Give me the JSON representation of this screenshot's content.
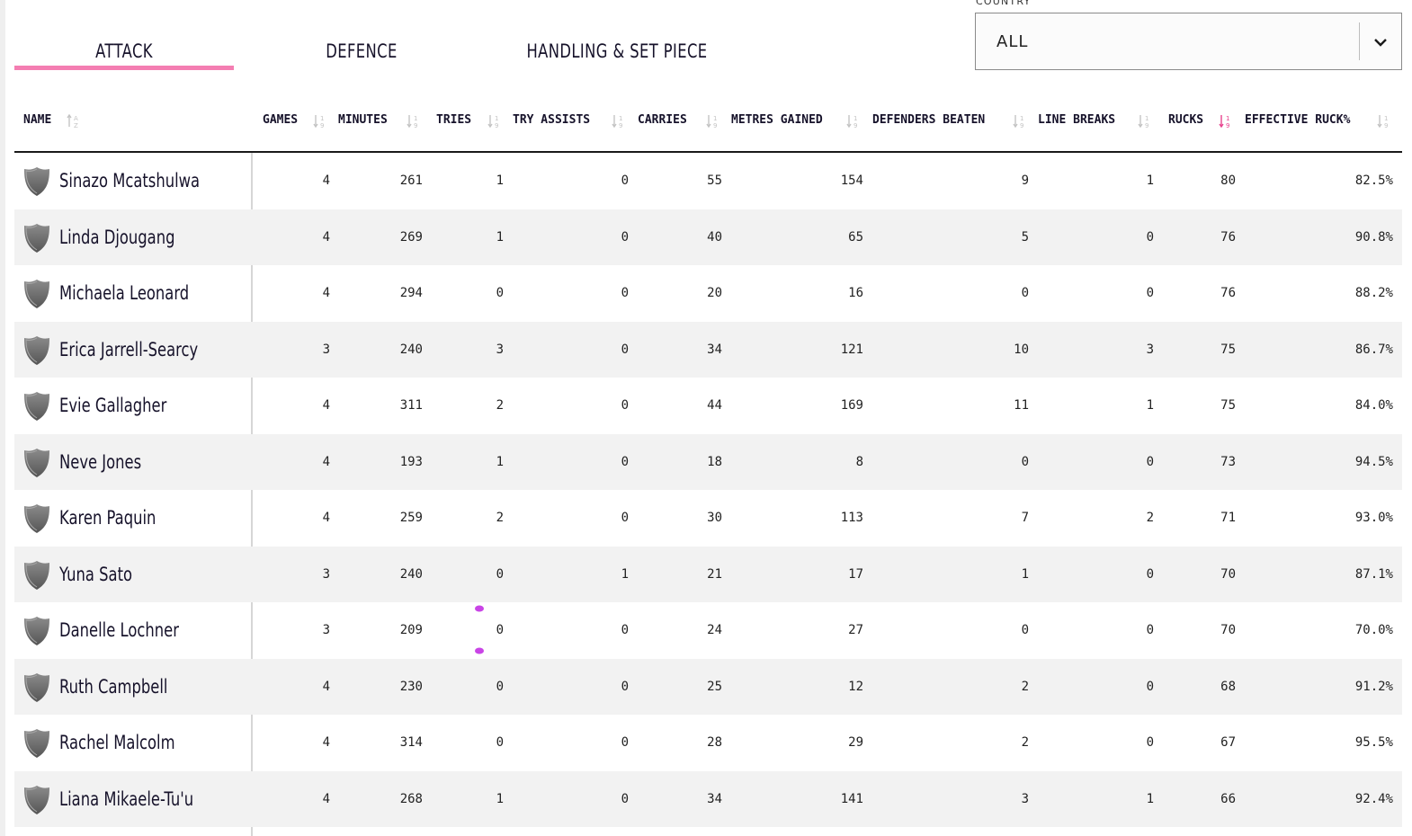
{
  "tabs": {
    "attack": "ATTACK",
    "defence": "DEFENCE",
    "handling": "HANDLING & SET PIECE"
  },
  "filter": {
    "label": "COUNTRY",
    "value": "ALL"
  },
  "colors": {
    "accent_pink": "#f47eb2",
    "active_sort": "#e8448f",
    "row_alt": "#f2f2f2"
  },
  "columns": {
    "name": "NAME",
    "games": "GAMES",
    "minutes": "MINUTES",
    "tries": "TRIES",
    "try_assists": "TRY ASSISTS",
    "carries": "CARRIES",
    "metres_gained": "METRES GAINED",
    "defenders_beaten": "DEFENDERS BEATEN",
    "line_breaks": "LINE BREAKS",
    "rucks": "RUCKS",
    "effective_ruck": "EFFECTIVE RUCK%"
  },
  "sorted_column": "rucks",
  "players": [
    {
      "name": "Sinazo Mcatshulwa",
      "games": "4",
      "minutes": "261",
      "tries": "1",
      "try_assists": "0",
      "carries": "55",
      "metres_gained": "154",
      "defenders_beaten": "9",
      "line_breaks": "1",
      "rucks": "80",
      "effective_ruck": "82.5%"
    },
    {
      "name": "Linda Djougang",
      "games": "4",
      "minutes": "269",
      "tries": "1",
      "try_assists": "0",
      "carries": "40",
      "metres_gained": "65",
      "defenders_beaten": "5",
      "line_breaks": "0",
      "rucks": "76",
      "effective_ruck": "90.8%"
    },
    {
      "name": "Michaela Leonard",
      "games": "4",
      "minutes": "294",
      "tries": "0",
      "try_assists": "0",
      "carries": "20",
      "metres_gained": "16",
      "defenders_beaten": "0",
      "line_breaks": "0",
      "rucks": "76",
      "effective_ruck": "88.2%"
    },
    {
      "name": "Erica Jarrell-Searcy",
      "games": "3",
      "minutes": "240",
      "tries": "3",
      "try_assists": "0",
      "carries": "34",
      "metres_gained": "121",
      "defenders_beaten": "10",
      "line_breaks": "3",
      "rucks": "75",
      "effective_ruck": "86.7%"
    },
    {
      "name": "Evie Gallagher",
      "games": "4",
      "minutes": "311",
      "tries": "2",
      "try_assists": "0",
      "carries": "44",
      "metres_gained": "169",
      "defenders_beaten": "11",
      "line_breaks": "1",
      "rucks": "75",
      "effective_ruck": "84.0%"
    },
    {
      "name": "Neve Jones",
      "games": "4",
      "minutes": "193",
      "tries": "1",
      "try_assists": "0",
      "carries": "18",
      "metres_gained": "8",
      "defenders_beaten": "0",
      "line_breaks": "0",
      "rucks": "73",
      "effective_ruck": "94.5%"
    },
    {
      "name": "Karen Paquin",
      "games": "4",
      "minutes": "259",
      "tries": "2",
      "try_assists": "0",
      "carries": "30",
      "metres_gained": "113",
      "defenders_beaten": "7",
      "line_breaks": "2",
      "rucks": "71",
      "effective_ruck": "93.0%"
    },
    {
      "name": "Yuna Sato",
      "games": "3",
      "minutes": "240",
      "tries": "0",
      "try_assists": "1",
      "carries": "21",
      "metres_gained": "17",
      "defenders_beaten": "1",
      "line_breaks": "0",
      "rucks": "70",
      "effective_ruck": "87.1%"
    },
    {
      "name": "Danelle Lochner",
      "games": "3",
      "minutes": "209",
      "tries": "0",
      "try_assists": "0",
      "carries": "24",
      "metres_gained": "27",
      "defenders_beaten": "0",
      "line_breaks": "0",
      "rucks": "70",
      "effective_ruck": "70.0%"
    },
    {
      "name": "Ruth Campbell",
      "games": "4",
      "minutes": "230",
      "tries": "0",
      "try_assists": "0",
      "carries": "25",
      "metres_gained": "12",
      "defenders_beaten": "2",
      "line_breaks": "0",
      "rucks": "68",
      "effective_ruck": "91.2%"
    },
    {
      "name": "Rachel Malcolm",
      "games": "4",
      "minutes": "314",
      "tries": "0",
      "try_assists": "0",
      "carries": "28",
      "metres_gained": "29",
      "defenders_beaten": "2",
      "line_breaks": "0",
      "rucks": "67",
      "effective_ruck": "95.5%"
    },
    {
      "name": "Liana Mikaele-Tu'u",
      "games": "4",
      "minutes": "268",
      "tries": "1",
      "try_assists": "0",
      "carries": "34",
      "metres_gained": "141",
      "defenders_beaten": "3",
      "line_breaks": "1",
      "rucks": "66",
      "effective_ruck": "92.4%"
    }
  ]
}
